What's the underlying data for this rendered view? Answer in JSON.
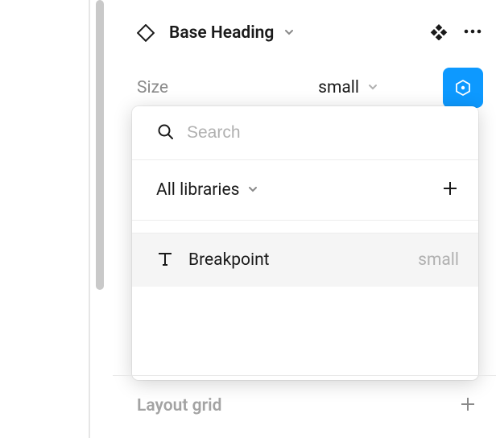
{
  "header": {
    "title": "Base Heading"
  },
  "property": {
    "label": "Size",
    "value": "small"
  },
  "popover": {
    "search_placeholder": "Search",
    "libraries_label": "All libraries",
    "option": {
      "label": "Breakpoint",
      "value": "small"
    }
  },
  "layout_grid": {
    "label": "Layout grid"
  }
}
